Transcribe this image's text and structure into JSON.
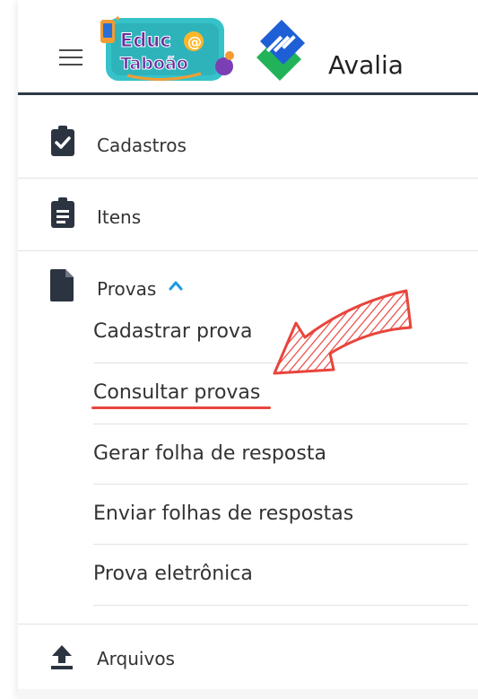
{
  "header": {
    "app_name": "Avalia",
    "logo_line1": "Educ@",
    "logo_line2": "Taboão"
  },
  "menu": {
    "cadastros": "Cadastros",
    "itens": "Itens",
    "provas": "Provas",
    "provas_sub": [
      "Cadastrar prova",
      "Consultar provas",
      "Gerar folha de resposta",
      "Enviar folhas de respostas",
      "Prova eletrônica"
    ],
    "arquivos": "Arquivos"
  },
  "colors": {
    "accent": "#1e9be0",
    "annotation": "#e8453c",
    "header_rule": "#2e3a48"
  }
}
